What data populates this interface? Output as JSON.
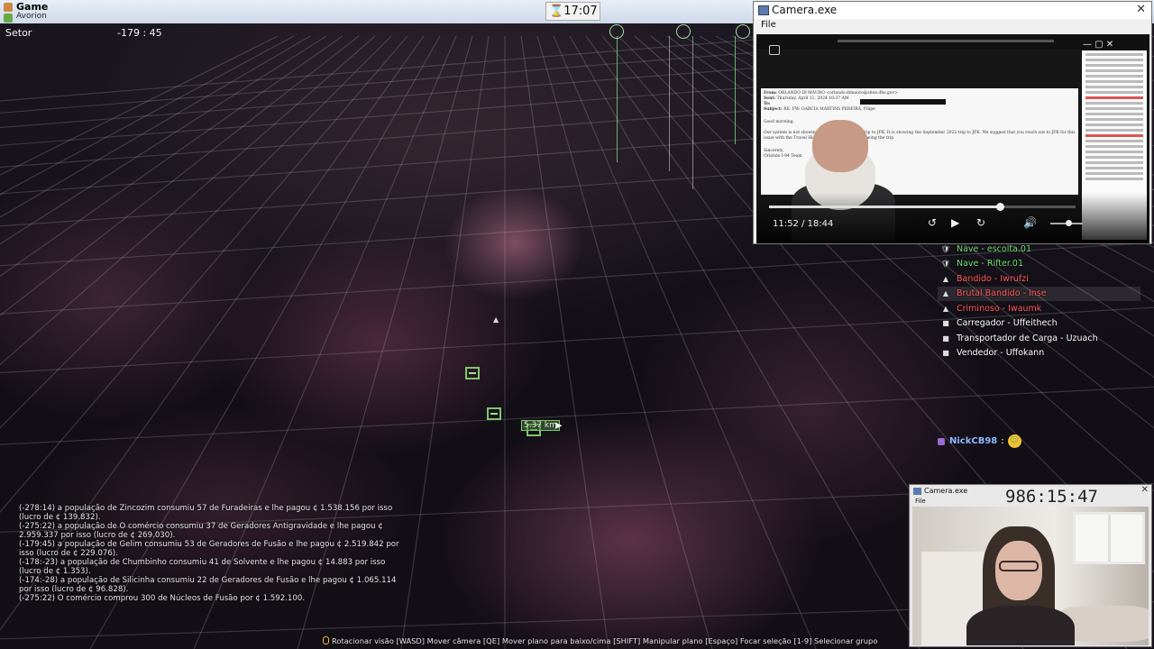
{
  "window": {
    "title": "Game",
    "subtitle": "Avorion",
    "clock": "17:07"
  },
  "hud": {
    "sector_label": "Setor",
    "sector_coords": "-179 : 45",
    "target_label": "5.37 km"
  },
  "log_messages": [
    "(-278:14) a população de Zincozim consumiu 57 de Furadeiras e lhe pagou ¢ 1.538.156 por isso (lucro de ¢ 139.832).",
    "(-275:22) a população de O comércio consumiu 37 de Geradores Antigravidade e lhe pagou ¢ 2.959.337 por isso (lucro de ¢ 269.030).",
    "(-179:45) a população de Gelim consumiu 53 de Geradores de Fusão e lhe pagou ¢ 2.519.842 por isso (lucro de ¢ 229.076).",
    "(-178:-23) a população de Chumbinho consumiu 41 de Solvente e lhe pagou ¢ 14.883 por isso (lucro de ¢ 1.353).",
    "(-174:-28) a população de Silicinha consumiu 22 de Geradores de Fusão e lhe pagou ¢ 1.065.114 por isso (lucro de ¢ 96.828).",
    "(-275:22) O comércio comprou 300 de Núcleos de Fusão por ¢ 1.592.100."
  ],
  "camera_main": {
    "title": "Camera.exe",
    "menu_file": "File",
    "video_time": "11:52 / 18:44",
    "progress": 0.754,
    "volume": 0.55,
    "email": {
      "from_label": "From:",
      "from_value": "ORLANDO DI MAURO <orlando.dimauro@sites.dhs.gov>",
      "sent_label": "Sent:",
      "sent_value": "Thursday, April 11, 2024 10:37 AM",
      "to_label": "To:",
      "subject_label": "Subject:",
      "subject_value": "RE: FW: GARCIA MARTINS PEREIRA, Filipe",
      "greeting": "Good morning,",
      "body": "Our system is not showing the September 2022 trip to JFK. It is showing the September 2022 trip to JFK. We suggest that you reach out to JFK for this issue with the Travel History since the person showing the trip",
      "closing": "Sincerely,",
      "signature": "Orlando I-94 Team"
    }
  },
  "object_list": [
    {
      "icon": "shield-icon",
      "label": "Nave - escolta.01",
      "color": "#6fdc6f"
    },
    {
      "icon": "shield-icon",
      "label": "Nave - Rifter.01",
      "color": "#6fdc6f"
    },
    {
      "icon": "triangle-icon",
      "label": "Bandido - Iwrufzi",
      "color": "#ff5a5a"
    },
    {
      "icon": "triangle-icon",
      "label": "Brutal Bandido - Inse",
      "color": "#ff5a5a"
    },
    {
      "icon": "triangle-icon",
      "label": "Criminoso - Iwaumk",
      "color": "#ff5a5a"
    },
    {
      "icon": "square-icon",
      "label": "Carregador - Uffeithech",
      "color": "#ffffff"
    },
    {
      "icon": "square-icon",
      "label": "Transportador de Carga - Uzuach",
      "color": "#ffffff"
    },
    {
      "icon": "square-icon",
      "label": "Vendedor - Uffokann",
      "color": "#ffffff"
    }
  ],
  "selected_object_index": 3,
  "chat": {
    "user": "NickCB98",
    "separator": ":",
    "message_icon": "smile-emoji"
  },
  "camera_small": {
    "title": "Camera.exe",
    "menu_file": "File",
    "timer": "986:15:47"
  },
  "hints": "Rotacionar visão   [WASD] Mover câmera   [QE] Mover plano para baixo/cima   [SHIFT] Manipular plano   [Espaço] Focar seleção   [1-9] Selecionar grupo"
}
